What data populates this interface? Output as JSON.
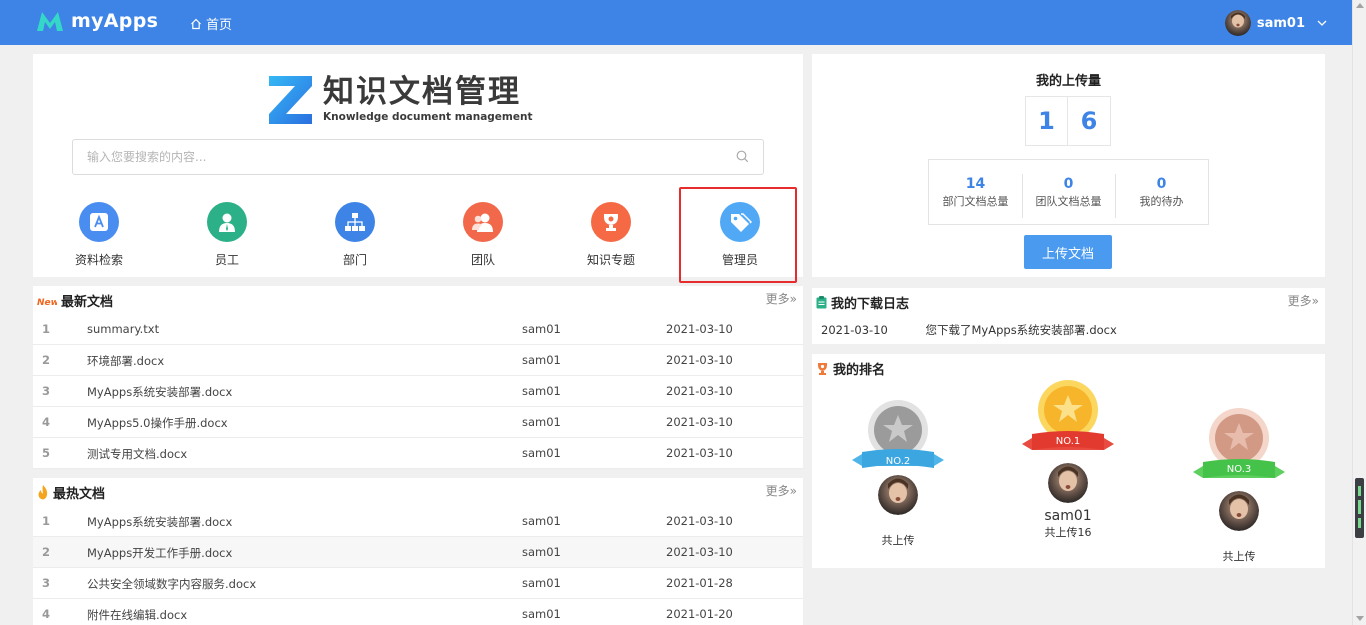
{
  "header": {
    "app_name": "myApps",
    "home_label": "首页",
    "username": "sam01"
  },
  "search_panel": {
    "brand_title": "知识文档管理",
    "brand_subtitle": "Knowledge document management",
    "search_placeholder": "输入您要搜索的内容...",
    "shortcuts": [
      {
        "label": "资料检索",
        "icon": "document-search-icon",
        "color": "#4a8df0"
      },
      {
        "label": "员工",
        "icon": "employee-icon",
        "color": "#2bb088"
      },
      {
        "label": "部门",
        "icon": "org-chart-icon",
        "color": "#3d84e6"
      },
      {
        "label": "团队",
        "icon": "team-icon",
        "color": "#f2684a"
      },
      {
        "label": "知识专题",
        "icon": "trophy-icon",
        "color": "#f56a44"
      },
      {
        "label": "管理员",
        "icon": "tag-icon",
        "color": "#51a9f5"
      }
    ]
  },
  "upload_panel": {
    "title": "我的上传量",
    "digits": [
      "1",
      "6"
    ],
    "stats": [
      {
        "value": "14",
        "label": "部门文档总量"
      },
      {
        "value": "0",
        "label": "团队文档总量"
      },
      {
        "value": "0",
        "label": "我的待办"
      }
    ],
    "upload_button": "上传文档"
  },
  "latest_docs": {
    "title": "最新文档",
    "badge": "New",
    "more_label": "更多",
    "rows": [
      {
        "idx": "1",
        "name": "summary.txt",
        "user": "sam01",
        "date": "2021-03-10"
      },
      {
        "idx": "2",
        "name": "环境部署.docx",
        "user": "sam01",
        "date": "2021-03-10"
      },
      {
        "idx": "3",
        "name": "MyApps系统安装部署.docx",
        "user": "sam01",
        "date": "2021-03-10"
      },
      {
        "idx": "4",
        "name": "MyApps5.0操作手册.docx",
        "user": "sam01",
        "date": "2021-03-10"
      },
      {
        "idx": "5",
        "name": "测试专用文档.docx",
        "user": "sam01",
        "date": "2021-03-10"
      }
    ]
  },
  "hot_docs": {
    "title": "最热文档",
    "more_label": "更多",
    "rows": [
      {
        "idx": "1",
        "name": "MyApps系统安装部署.docx",
        "user": "sam01",
        "date": "2021-03-10"
      },
      {
        "idx": "2",
        "name": "MyApps开发工作手册.docx",
        "user": "sam01",
        "date": "2021-03-10"
      },
      {
        "idx": "3",
        "name": "公共安全领域数字内容服务.docx",
        "user": "sam01",
        "date": "2021-01-28"
      },
      {
        "idx": "4",
        "name": "附件在线编辑.docx",
        "user": "sam01",
        "date": "2021-01-20"
      }
    ]
  },
  "download_log": {
    "title": "我的下载日志",
    "more_label": "更多",
    "entries": [
      {
        "date": "2021-03-10",
        "text": "您下载了MyApps系统安装部署.docx"
      }
    ]
  },
  "ranking": {
    "title": "我的排名",
    "ranks": [
      {
        "badge": "NO.2",
        "name": "",
        "count": "共上传"
      },
      {
        "badge": "NO.1",
        "name": "sam01",
        "count": "共上传16"
      },
      {
        "badge": "NO.3",
        "name": "",
        "count": "共上传"
      }
    ]
  },
  "colors": {
    "header_bg": "#3d84e6",
    "accent": "#3d84e6",
    "highlight_box": "#e62c2c",
    "upload_button": "#4a9bf0"
  }
}
